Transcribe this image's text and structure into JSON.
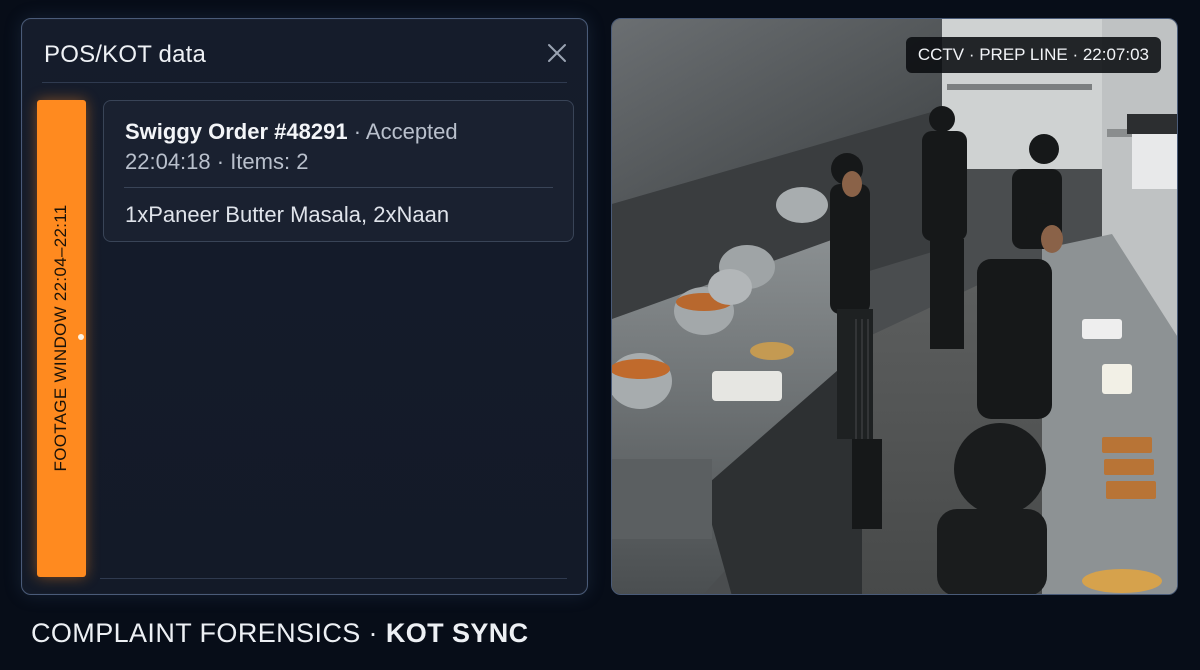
{
  "panel": {
    "title": "POS/KOT data",
    "close_icon": "close-icon"
  },
  "footage_window": {
    "label": "FOOTAGE WINDOW 22:04–22:11",
    "color": "#ff8a1f"
  },
  "order": {
    "id": "Swiggy Order #48291",
    "status": "· Accepted",
    "time_items": "22:04:18 · Items: 2",
    "items": "1xPaneer Butter Masala, 2xNaan"
  },
  "cctv": {
    "label": "CCTV · PREP LINE · 22:07:03"
  },
  "caption": {
    "prefix": "COMPLAINT FORENSICS · ",
    "emphasis": "KOT SYNC"
  }
}
